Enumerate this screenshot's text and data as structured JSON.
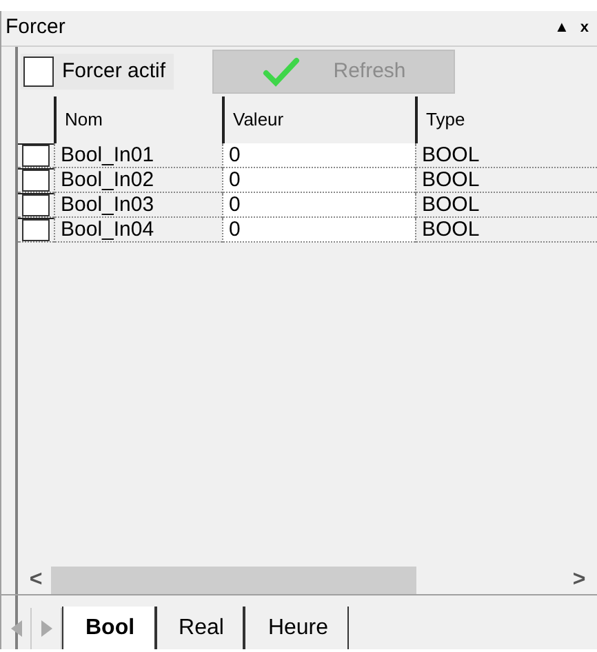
{
  "window": {
    "title": "Forcer",
    "buttons": [
      "▲",
      "x"
    ]
  },
  "toolbar": {
    "force_active": {
      "label": "Forcer actif",
      "checked": false
    },
    "refresh": {
      "label": "Refresh",
      "disabled": true
    }
  },
  "table": {
    "columns": [
      "Nom",
      "Valeur",
      "Type"
    ],
    "rows": [
      {
        "checked": false,
        "cells": [
          "Bool_In01",
          "0",
          "BOOL"
        ]
      },
      {
        "checked": false,
        "cells": [
          "Bool_In02",
          "0",
          "BOOL"
        ]
      },
      {
        "checked": false,
        "cells": [
          "Bool_In03",
          "0",
          "BOOL"
        ]
      },
      {
        "checked": false,
        "cells": [
          "Bool_In04",
          "0",
          "BOOL"
        ]
      }
    ]
  },
  "scrollbar": {
    "left": "<",
    "right": ">"
  },
  "tabs": [
    {
      "label": "Bool",
      "selected": true
    },
    {
      "label": "Real",
      "selected": false
    },
    {
      "label": "Heure",
      "selected": false
    }
  ]
}
